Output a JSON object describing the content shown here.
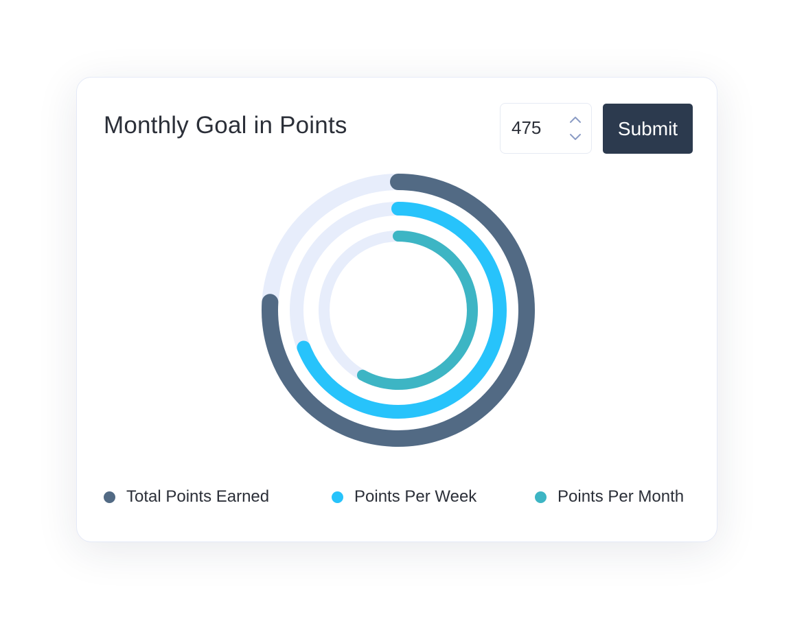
{
  "card": {
    "title": "Monthly Goal in Points",
    "goal_input": {
      "value": "475"
    },
    "submit_label": "Submit"
  },
  "colors": {
    "track": "#e7edfb",
    "total": "#526a84",
    "week": "#27c3fb",
    "month": "#3db5c4",
    "button": "#2c3a4e",
    "stepper": "#8a9bc4"
  },
  "icons": {
    "step_up": "chevron-up-icon",
    "step_down": "chevron-down-icon"
  },
  "chart_data": {
    "type": "radial-bar",
    "start_angle_deg": 0,
    "direction": "clockwise",
    "max_percent": 100,
    "series": [
      {
        "name": "Total Points Earned",
        "percent": 76,
        "color": "#526a84"
      },
      {
        "name": "Points Per Week",
        "percent": 69,
        "color": "#27c3fb"
      },
      {
        "name": "Points Per Month",
        "percent": 58,
        "color": "#3db5c4"
      }
    ],
    "legend": {
      "position": "bottom",
      "items": [
        "Total Points Earned",
        "Points Per Week",
        "Points Per Month"
      ]
    }
  }
}
